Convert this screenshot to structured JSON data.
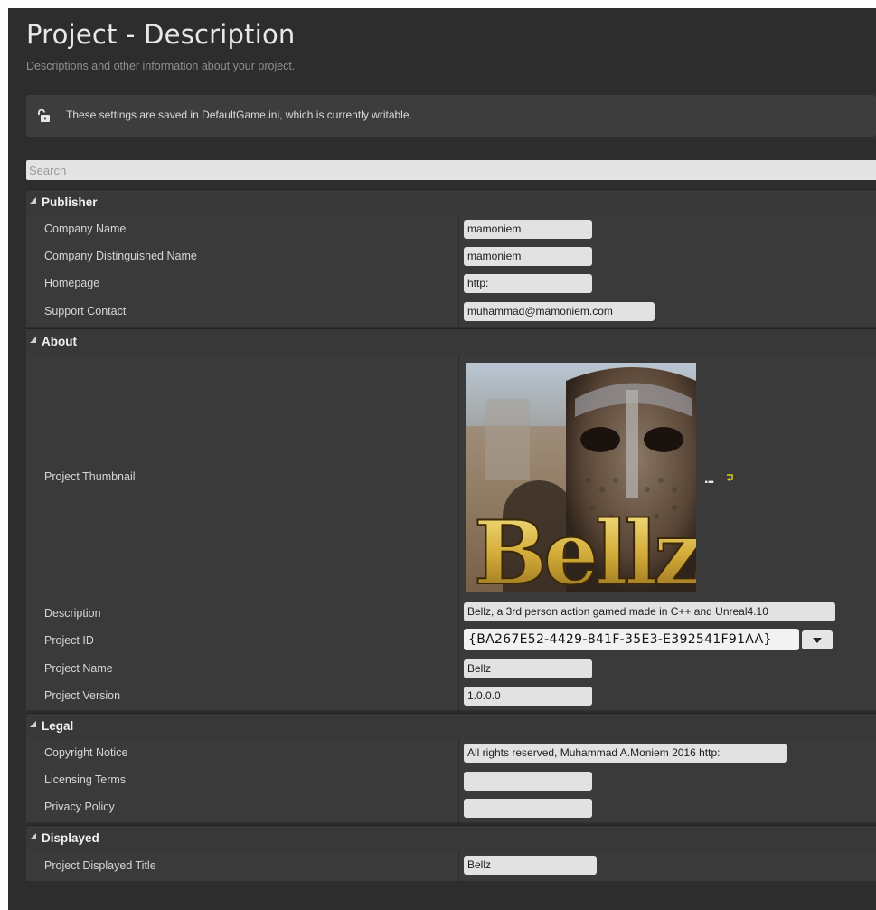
{
  "header": {
    "title": "Project - Description",
    "subtitle": "Descriptions and other information about your project."
  },
  "notice": {
    "icon": "lock-open-icon",
    "text": "These settings are saved in DefaultGame.ini, which is currently writable."
  },
  "search": {
    "placeholder": "Search",
    "value": ""
  },
  "categories": {
    "publisher": {
      "label": "Publisher",
      "rows": [
        {
          "name": "Company Name",
          "value": "mamoniem"
        },
        {
          "name": "Company Distinguished Name",
          "value": "mamoniem"
        },
        {
          "name": "Homepage",
          "value": "http:"
        },
        {
          "name": "Support Contact",
          "value": "muhammad@mamoniem.com"
        }
      ]
    },
    "about": {
      "label": "About",
      "thumbnail": {
        "name": "Project Thumbnail",
        "image_text": "Bellz",
        "browse_label": "...",
        "reset_icon": "reset-to-default-icon"
      },
      "rows": [
        {
          "name": "Description",
          "value": "Bellz, a 3rd person action gamed made in C++ and Unreal4.10"
        },
        {
          "name": "Project ID",
          "value": "{BA267E52-4429-841F-35E3-E392541F91AA}",
          "dropdown_icon": "chevron-down-icon"
        },
        {
          "name": "Project Name",
          "value": "Bellz"
        },
        {
          "name": "Project Version",
          "value": "1.0.0.0"
        }
      ]
    },
    "legal": {
      "label": "Legal",
      "rows": [
        {
          "name": "Copyright Notice",
          "value": "All rights reserved, Muhammad A.Moniem 2016 http:"
        },
        {
          "name": "Licensing Terms",
          "value": ""
        },
        {
          "name": "Privacy Policy",
          "value": ""
        }
      ]
    },
    "displayed": {
      "label": "Displayed",
      "rows": [
        {
          "name": "Project Displayed Title",
          "value": "Bellz"
        }
      ]
    }
  },
  "colors": {
    "panel_bg": "#2d2d2d",
    "row_bg": "#3a3a3a",
    "category_bg": "#383838",
    "field_bg": "#e2e2e2",
    "text_light": "#d6d6d6",
    "reset_accent": "#e0d012"
  }
}
